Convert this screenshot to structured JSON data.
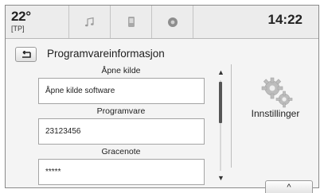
{
  "status_bar": {
    "temperature": "22°",
    "traffic_program": "[TP]",
    "time": "14:22",
    "icons": [
      "music-note-icon",
      "phone-icon",
      "radio-station-icon"
    ]
  },
  "header": {
    "back_icon": "back-arrow-icon",
    "title": "Programvareinformasjon"
  },
  "info_items": [
    {
      "label": "Åpne kilde",
      "value": "Åpne kilde software"
    },
    {
      "label": "Programvare",
      "value": "23123456"
    },
    {
      "label": "Gracenote",
      "value": "*****"
    }
  ],
  "scrollbar": {
    "up_icon": "scroll-up-arrow-icon",
    "down_icon": "scroll-down-arrow-icon"
  },
  "settings": {
    "icon": "gears-icon",
    "label": "Innstillinger"
  },
  "bottom": {
    "up_icon": "caret-up-icon",
    "up_glyph": "^"
  }
}
